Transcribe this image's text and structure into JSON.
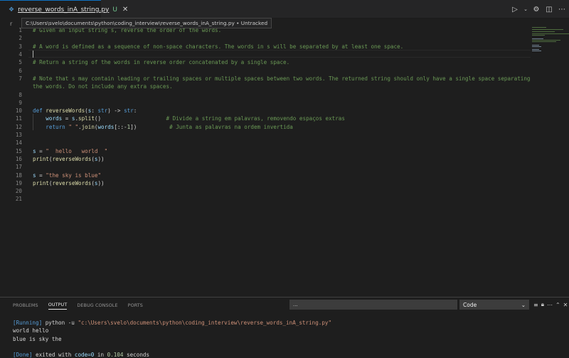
{
  "tab": {
    "filename": "reverse_words_inA_string.py",
    "state": "U",
    "close": "✕"
  },
  "tooltip": "C:\\Users\\svelo\\documents\\python\\coding_interview\\reverse_words_inA_string.py • Untracked",
  "breadcrumb_initial": "r",
  "editor": {
    "lines": [
      {
        "n": "1",
        "segs": [
          {
            "c": "com",
            "t": "# Given an input string s, reverse the order of the words."
          }
        ]
      },
      {
        "n": "2",
        "segs": []
      },
      {
        "n": "3",
        "segs": [
          {
            "c": "com",
            "t": "# A word is defined as a sequence of non-space characters. The words in s will be separated by at least one space."
          }
        ]
      },
      {
        "n": "4",
        "segs": []
      },
      {
        "n": "5",
        "segs": [
          {
            "c": "com",
            "t": "# Return a string of the words in reverse order concatenated by a single space."
          }
        ]
      },
      {
        "n": "6",
        "segs": []
      },
      {
        "n": "7",
        "segs": [
          {
            "c": "com",
            "t": "# Note that s may contain leading or trailing spaces or multiple spaces between two words. The returned string should only have a single space separating"
          }
        ]
      },
      {
        "n": "",
        "segs": [
          {
            "c": "com",
            "t": "the words. Do not include any extra spaces."
          }
        ]
      },
      {
        "n": "8",
        "segs": []
      },
      {
        "n": "9",
        "segs": []
      },
      {
        "n": "10",
        "segs": [
          {
            "c": "kw",
            "t": "def "
          },
          {
            "c": "fn",
            "t": "reverseWords"
          },
          {
            "c": "op",
            "t": "("
          },
          {
            "c": "var",
            "t": "s"
          },
          {
            "c": "op",
            "t": ": "
          },
          {
            "c": "kw",
            "t": "str"
          },
          {
            "c": "op",
            "t": ") -> "
          },
          {
            "c": "kw",
            "t": "str"
          },
          {
            "c": "op",
            "t": ":"
          }
        ]
      },
      {
        "n": "11",
        "segs": [
          {
            "c": "op",
            "t": "    "
          },
          {
            "c": "var",
            "t": "words"
          },
          {
            "c": "op",
            "t": " = "
          },
          {
            "c": "var",
            "t": "s"
          },
          {
            "c": "op",
            "t": "."
          },
          {
            "c": "fn",
            "t": "split"
          },
          {
            "c": "op",
            "t": "()                    "
          },
          {
            "c": "com",
            "t": "# Divide a string em palavras, removendo espaços extras"
          }
        ]
      },
      {
        "n": "12",
        "segs": [
          {
            "c": "op",
            "t": "    "
          },
          {
            "c": "kw",
            "t": "return"
          },
          {
            "c": "op",
            "t": " "
          },
          {
            "c": "str",
            "t": "\" \""
          },
          {
            "c": "op",
            "t": "."
          },
          {
            "c": "fn",
            "t": "join"
          },
          {
            "c": "op",
            "t": "("
          },
          {
            "c": "var",
            "t": "words"
          },
          {
            "c": "op",
            "t": "[::-"
          },
          {
            "c": "num",
            "t": "1"
          },
          {
            "c": "op",
            "t": "])          "
          },
          {
            "c": "com",
            "t": "# Junta as palavras na ordem invertida"
          }
        ]
      },
      {
        "n": "13",
        "segs": []
      },
      {
        "n": "14",
        "segs": []
      },
      {
        "n": "15",
        "segs": [
          {
            "c": "var",
            "t": "s"
          },
          {
            "c": "op",
            "t": " = "
          },
          {
            "c": "str",
            "t": "\"  hello   world  \""
          }
        ]
      },
      {
        "n": "16",
        "segs": [
          {
            "c": "fn",
            "t": "print"
          },
          {
            "c": "op",
            "t": "("
          },
          {
            "c": "fn",
            "t": "reverseWords"
          },
          {
            "c": "op",
            "t": "("
          },
          {
            "c": "var",
            "t": "s"
          },
          {
            "c": "op",
            "t": "))"
          }
        ]
      },
      {
        "n": "17",
        "segs": []
      },
      {
        "n": "18",
        "segs": [
          {
            "c": "var",
            "t": "s"
          },
          {
            "c": "op",
            "t": " = "
          },
          {
            "c": "str",
            "t": "\"the sky is blue\""
          }
        ]
      },
      {
        "n": "19",
        "segs": [
          {
            "c": "fn",
            "t": "print"
          },
          {
            "c": "op",
            "t": "("
          },
          {
            "c": "fn",
            "t": "reverseWords"
          },
          {
            "c": "op",
            "t": "("
          },
          {
            "c": "var",
            "t": "s"
          },
          {
            "c": "op",
            "t": "))"
          }
        ]
      },
      {
        "n": "20",
        "segs": []
      },
      {
        "n": "21",
        "segs": []
      }
    ]
  },
  "panel": {
    "tabs": [
      "PROBLEMS",
      "OUTPUT",
      "DEBUG CONSOLE",
      "PORTS"
    ],
    "active_tab": "OUTPUT",
    "filter_value": "...",
    "channel": "Code",
    "output": {
      "run_tag": "[Running]",
      "run_cmd": " python -u ",
      "run_path": "\"c:\\Users\\svelo\\documents\\python\\coding_interview\\reverse_words_inA_string.py\"",
      "line1": "world hello",
      "line2": "blue is sky the",
      "done_tag": "[Done]",
      "done_text1": " exited with ",
      "done_code": "code=0",
      "done_text2": " in ",
      "done_time": "0.104",
      "done_text3": " seconds"
    }
  },
  "icons": {
    "python_file": "python-file-icon",
    "run": "run-icon",
    "settings": "settings-icon",
    "split": "split-editor-icon",
    "more": "more-icon"
  }
}
